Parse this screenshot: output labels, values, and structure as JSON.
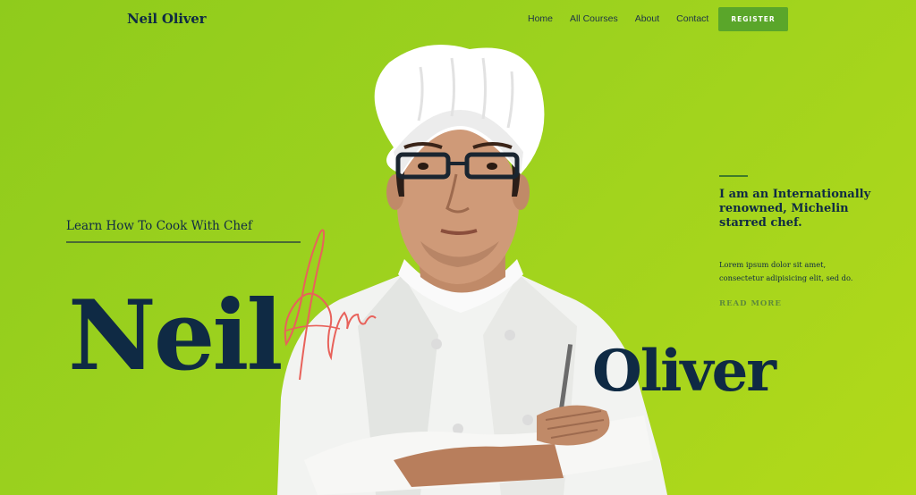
{
  "brand": {
    "name": "Neil Oliver"
  },
  "nav": {
    "items": [
      {
        "label": "Home"
      },
      {
        "label": "All Courses"
      },
      {
        "label": "About"
      },
      {
        "label": "Contact"
      }
    ],
    "register_label": "REGISTER"
  },
  "hero": {
    "subtitle": "Learn How To Cook With Chef",
    "first_name": "Neil",
    "last_name": "Oliver",
    "image": "chef-portrait",
    "signature": "handwritten-signature"
  },
  "sidebar": {
    "heading": "I am an Internationally renowned, Michelin starred chef.",
    "body": "Lorem ipsum dolor sit amet, consectetur adipisicing elit, sed do.",
    "read_more": "READ MORE"
  },
  "colors": {
    "background": "#9dd21e",
    "text": "#0f2a44",
    "button": "#5aa62a",
    "signature": "#e8625b"
  }
}
